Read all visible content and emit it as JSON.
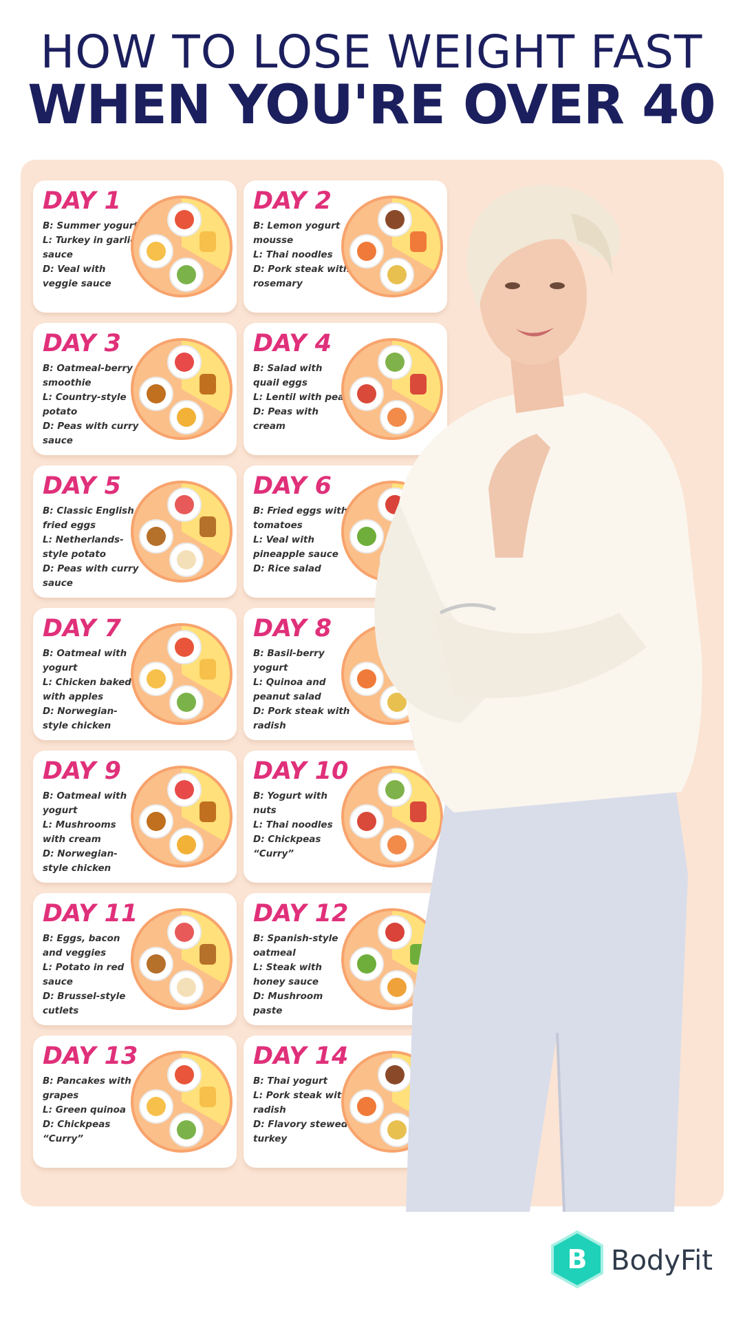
{
  "header": {
    "line1": "HOW TO LOSE WEIGHT FAST",
    "line2": "WHEN YOU'RE OVER 40"
  },
  "days": [
    {
      "title": "DAY 1",
      "meals": [
        "B: Summer yogurt",
        "L: Turkey in garlic sauce",
        "D: Veal with veggie sauce"
      ]
    },
    {
      "title": "DAY 2",
      "meals": [
        "B: Lemon yogurt mousse",
        "L: Thai noodles",
        "D: Pork steak with rosemary"
      ]
    },
    {
      "title": "DAY 3",
      "meals": [
        "B: Oatmeal-berry smoothie",
        "L: Country-style potato",
        "D: Peas with curry sauce"
      ]
    },
    {
      "title": "DAY 4",
      "meals": [
        "B: Salad with quail eggs",
        "L: Lentil with peas",
        "D: Peas with cream"
      ]
    },
    {
      "title": "DAY 5",
      "meals": [
        "B: Classic English fried eggs",
        "L: Netherlands-style potato",
        "D: Peas with curry sauce"
      ]
    },
    {
      "title": "DAY 6",
      "meals": [
        "B: Fried eggs with tomatoes",
        "L: Veal with pineapple sauce",
        "D: Rice salad"
      ]
    },
    {
      "title": "DAY 7",
      "meals": [
        "B: Oatmeal with yogurt",
        "L: Chicken baked with apples",
        "D: Norwegian-style chicken"
      ]
    },
    {
      "title": "DAY 8",
      "meals": [
        "B: Basil-berry yogurt",
        "L: Quinoa and peanut salad",
        "D: Pork steak with radish"
      ]
    },
    {
      "title": "DAY 9",
      "meals": [
        "B: Oatmeal with yogurt",
        "L: Mushrooms with cream",
        "D: Norwegian-style chicken"
      ]
    },
    {
      "title": "DAY 10",
      "meals": [
        "B: Yogurt with nuts",
        "L: Thai noodles",
        "D: Chickpeas “Curry”"
      ]
    },
    {
      "title": "DAY 11",
      "meals": [
        "B: Eggs, bacon and veggies",
        "L: Potato in red sauce",
        "D: Brussel-style cutlets"
      ]
    },
    {
      "title": "DAY 12",
      "meals": [
        "B: Spanish-style oatmeal",
        "L: Steak with honey sauce",
        "D: Mushroom paste"
      ]
    },
    {
      "title": "DAY 13",
      "meals": [
        "B: Pancakes with grapes",
        "L: Green quinoa",
        "D: Chickpeas “Curry”"
      ]
    },
    {
      "title": "DAY 14",
      "meals": [
        "B: Thai yogurt",
        "L: Pork steak with radish",
        "D: Flavory stewed turkey"
      ]
    }
  ],
  "brand": {
    "logo_letter": "B",
    "name": "BodyFit"
  },
  "colors": {
    "title": "#1c1f5e",
    "day_title": "#e0307a",
    "panel": "#fbe4d4",
    "plate_orange": "#fbbf8a",
    "plate_yellow": "#ffe07a",
    "logo_teal": "#1fd1b8"
  }
}
